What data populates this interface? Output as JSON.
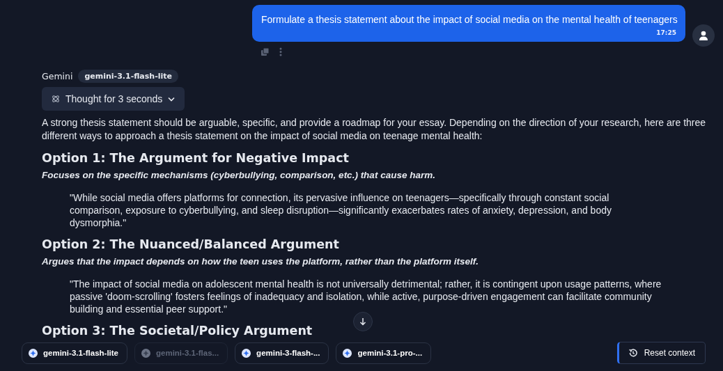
{
  "user_message": {
    "text": "Formulate a thesis statement about the impact of social media on the mental health of teenagers",
    "time": "17:25"
  },
  "assistant": {
    "name": "Gemini",
    "model": "gemini-3.1-flash-lite",
    "thought": {
      "label": "Thought for 3 seconds",
      "expanded": false
    },
    "intro": "A strong thesis statement should be arguable, specific, and provide a roadmap for your essay. Depending on the direction of your research, here are three different ways to approach a thesis statement on the impact of social media on teenage mental health:",
    "options": [
      {
        "heading": "Option 1: The Argument for Negative Impact",
        "summary": "Focuses on the specific mechanisms (cyberbullying, comparison, etc.) that cause harm.",
        "quote": "\"While social media offers platforms for connection, its pervasive influence on teenagers—specifically through constant social comparison, exposure to cyberbullying, and sleep disruption—significantly exacerbates rates of anxiety, depression, and body dysmorphia.\""
      },
      {
        "heading": "Option 2: The Nuanced/Balanced Argument",
        "summary": "Argues that the impact depends on how the teen uses the platform, rather than the platform itself.",
        "quote": "\"The impact of social media on adolescent mental health is not universally detrimental; rather, it is contingent upon usage patterns, where passive 'doom-scrolling' fosters feelings of inadequacy and isolation, while active, purpose-driven engagement can facilitate community building and essential peer support.\""
      },
      {
        "heading": "Option 3: The Societal/Policy Argument"
      }
    ]
  },
  "model_chips": [
    {
      "label": "gemini-3.1-flash-lite",
      "disabled": false
    },
    {
      "label": "gemini-3.1-flas...",
      "disabled": true
    },
    {
      "label": "gemini-3-flash-...",
      "disabled": false
    },
    {
      "label": "gemini-3.1-pro-...",
      "disabled": false
    }
  ],
  "reset_button": "Reset context"
}
